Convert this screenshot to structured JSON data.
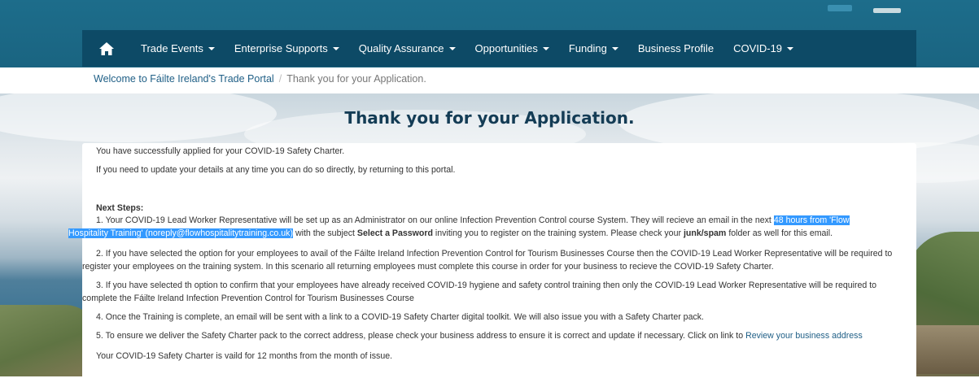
{
  "nav": {
    "home_icon": "home-icon",
    "items": [
      {
        "label": "Trade Events",
        "dropdown": true
      },
      {
        "label": "Enterprise Supports",
        "dropdown": true
      },
      {
        "label": "Quality Assurance",
        "dropdown": true
      },
      {
        "label": "Opportunities",
        "dropdown": true
      },
      {
        "label": "Funding",
        "dropdown": true
      },
      {
        "label": "Business Profile",
        "dropdown": false
      },
      {
        "label": "COVID-19",
        "dropdown": true
      }
    ]
  },
  "breadcrumb": {
    "home": "Welcome to Fáilte Ireland's Trade Portal",
    "separator": "/",
    "current": "Thank you for your Application."
  },
  "page": {
    "title": "Thank you for your Application."
  },
  "content": {
    "intro1": "You have successfully applied for your COVID-19 Safety Charter.",
    "intro2": "If you need to update your details at any time you can do so directly, by returning to this portal.",
    "next_steps_heading": "Next Steps:",
    "step1_a": "1. Your COVID-19 Lead Worker Representative will be set up as an Administrator on our online Infection Prevention Control course System. They will recieve an email in the next",
    "step1_highlight_a": "48 hours from 'Flow",
    "step1_highlight_b": "Hospitality Training' (noreply@flowhospitalitytraining.co.uk)",
    "step1_b": "with the subject",
    "step1_bold1": "Select a Password",
    "step1_c": "inviting you to register on the training system. Please check your",
    "step1_bold2": "junk/spam",
    "step1_d": "folder as well for this email.",
    "step2": "2. If you have selected the option for your employees to avail of the Fáilte Ireland Infection Prevention Control for Tourism Businesses Course then the COVID-19 Lead Worker Representative will be required to register your employees on the training system. In this scenario all returning employees must complete this course in order for your business to recieve the COVID-19 Safety Charter.",
    "step3": "3. If you have selected th option to confirm that your employees have already received COVID-19 hygiene and safety control training then only the COVID-19 Lead Worker Representative will be required to complete the Fáilte Ireland Infection Prevention Control for Tourism Businesses Course",
    "step4": "4. Once the Training is complete, an email will be sent with a link to a COVID-19 Safety Charter digital toolkit. We will also issue you with a Safety Charter pack.",
    "step5": "5. To ensure we deliver the Safety Charter pack to the correct address, please check your business address to ensure it is correct and update if necessary. Click on link to",
    "step5_link": "Review your business address",
    "validity": "Your COVID-19 Safety Charter is vaild for 12 months from the month of issue."
  },
  "colors": {
    "navbar": "#0d4a66",
    "header_band": "#1d6d8b",
    "title": "#143c55",
    "link": "#1f5f86",
    "highlight": "#3399ff"
  }
}
